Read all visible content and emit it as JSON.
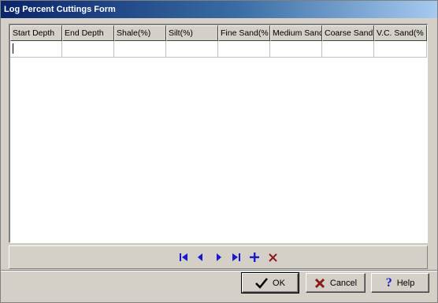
{
  "window": {
    "title": "Log Percent Cuttings Form"
  },
  "grid": {
    "columns": [
      "Start Depth",
      "End Depth",
      "Shale(%)",
      "Silt(%)",
      "Fine Sand(%",
      "Medium Sand",
      "Coarse Sand",
      "V.C. Sand(%"
    ],
    "rows": [
      [
        "",
        "",
        "",
        "",
        "",
        "",
        "",
        ""
      ]
    ]
  },
  "navigator": {
    "icons": [
      "first-record-icon",
      "prior-record-icon",
      "next-record-icon",
      "last-record-icon",
      "insert-record-icon",
      "delete-record-icon"
    ],
    "color": "#1a1acc"
  },
  "buttons": {
    "ok": {
      "label": "OK",
      "icon": "checkmark-icon"
    },
    "cancel": {
      "label": "Cancel",
      "icon": "x-icon"
    },
    "help": {
      "label": "Help",
      "icon": "question-icon"
    }
  }
}
